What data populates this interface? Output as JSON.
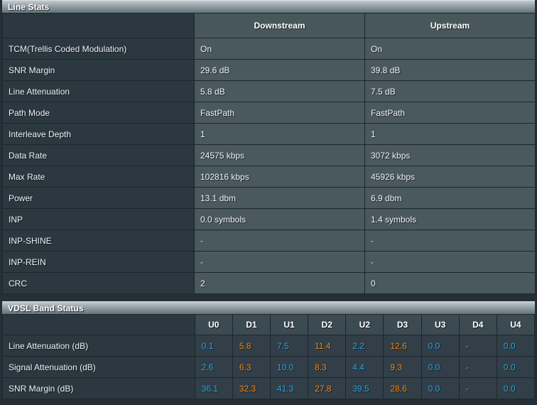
{
  "line_stats": {
    "title": "Line Stats",
    "columns": [
      "",
      "Downstream",
      "Upstream"
    ],
    "rows": [
      {
        "label": "TCM(Trellis Coded Modulation)",
        "downstream": "On",
        "upstream": "On"
      },
      {
        "label": "SNR Margin",
        "downstream": "29.6 dB",
        "upstream": "39.8 dB"
      },
      {
        "label": "Line Attenuation",
        "downstream": "5.8 dB",
        "upstream": "7.5 dB"
      },
      {
        "label": "Path Mode",
        "downstream": "FastPath",
        "upstream": "FastPath"
      },
      {
        "label": "Interleave Depth",
        "downstream": "1",
        "upstream": "1"
      },
      {
        "label": "Data Rate",
        "downstream": "24575 kbps",
        "upstream": "3072 kbps"
      },
      {
        "label": "Max Rate",
        "downstream": "102816 kbps",
        "upstream": "45926 kbps"
      },
      {
        "label": "Power",
        "downstream": "13.1 dbm",
        "upstream": "6.9 dbm"
      },
      {
        "label": "INP",
        "downstream": "0.0 symbols",
        "upstream": "1.4 symbols"
      },
      {
        "label": "INP-SHINE",
        "downstream": "-",
        "upstream": "-"
      },
      {
        "label": "INP-REIN",
        "downstream": "-",
        "upstream": "-"
      },
      {
        "label": "CRC",
        "downstream": "2",
        "upstream": "0"
      }
    ]
  },
  "band_status": {
    "title": "VDSL Band Status",
    "bands": [
      "U0",
      "D1",
      "U1",
      "D2",
      "U2",
      "D3",
      "U3",
      "D4",
      "U4"
    ],
    "corner_label": "",
    "rows": [
      {
        "label": "Line Attenuation (dB)",
        "values": [
          "0.1",
          "5.8",
          "7.5",
          "11.4",
          "2.2",
          "12.6",
          "0.0",
          "-",
          "0.0"
        ]
      },
      {
        "label": "Signal Attenuation (dB)",
        "values": [
          "2.6",
          "6.3",
          "10.0",
          "8.3",
          "4.4",
          "9.3",
          "0.0",
          "-",
          "0.0"
        ]
      },
      {
        "label": "SNR Margin (dB)",
        "values": [
          "36.1",
          "32.3",
          "41.3",
          "27.8",
          "39.5",
          "28.6",
          "0.0",
          "-",
          "0.0"
        ]
      }
    ]
  },
  "colors": {
    "upstream_value": "#2ba6dd",
    "downstream_value": "#f0841a",
    "panel_background": "#2b3840",
    "value_cell_background": "#4a595e",
    "page_background": "#242f37",
    "text": "#eef3f6"
  }
}
